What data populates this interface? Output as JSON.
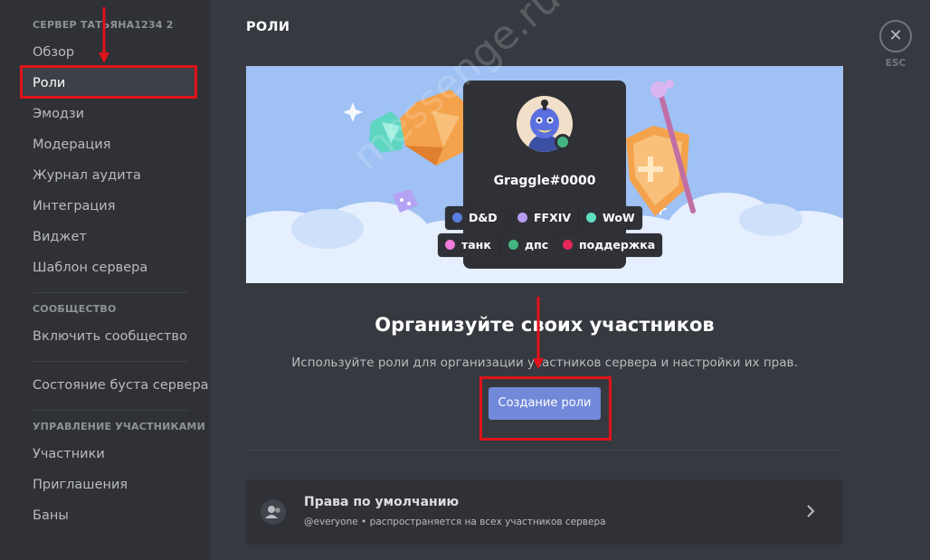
{
  "sidebar": {
    "server_header": "СЕРВЕР ТАТЬЯНА1234 2",
    "server_items": [
      {
        "label": "Обзор"
      },
      {
        "label": "Роли"
      },
      {
        "label": "Эмодзи"
      },
      {
        "label": "Модерация"
      },
      {
        "label": "Журнал аудита"
      },
      {
        "label": "Интеграция"
      },
      {
        "label": "Виджет"
      },
      {
        "label": "Шаблон сервера"
      }
    ],
    "community_header": "СООБЩЕСТВО",
    "community_items": [
      {
        "label": "Включить сообщество"
      }
    ],
    "boost_label": "Состояние буста сервера",
    "members_header": "УПРАВЛЕНИЕ УЧАСТНИКАМИ",
    "member_items": [
      {
        "label": "Участники"
      },
      {
        "label": "Приглашения"
      },
      {
        "label": "Баны"
      }
    ],
    "active_item": "Роли"
  },
  "header": {
    "title": "РОЛИ",
    "esc_label": "ESC"
  },
  "banner": {
    "username": "Graggle#0000",
    "roles": [
      {
        "label": "D&D",
        "color": "#5a7fe0"
      },
      {
        "label": "FFXIV",
        "color": "#b79cf0"
      },
      {
        "label": "WoW",
        "color": "#5fe0c4"
      },
      {
        "label": "танк",
        "color": "#f37bd9"
      },
      {
        "label": "дпс",
        "color": "#43b581"
      },
      {
        "label": "поддержка",
        "color": "#e8285a"
      }
    ]
  },
  "empty_state": {
    "headline": "Организуйте своих участников",
    "description": "Используйте роли для организации участников сервера и настройки их прав.",
    "create_button": "Создание роли"
  },
  "default_permissions": {
    "title": "Права по умолчанию",
    "subtitle": "@everyone • распространяется на всех участников сервера"
  },
  "watermark": "messenge.ru",
  "colors": {
    "accent": "#7289da",
    "annotation": "#e0131a",
    "online": "#43b581"
  }
}
